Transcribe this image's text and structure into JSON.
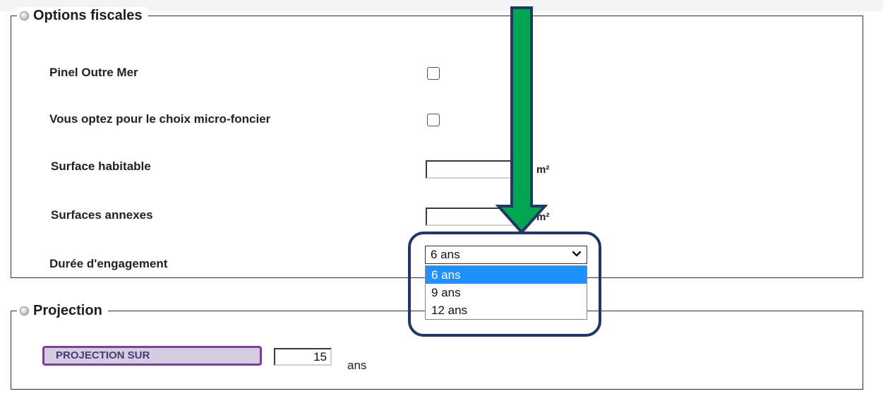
{
  "fiscal": {
    "title": "Options fiscales",
    "pinel_label": "Pinel Outre Mer",
    "microfoncier_label": "Vous optez pour le choix micro-foncier",
    "surface_label": "Surface habitable",
    "surface_unit": "m²",
    "annexes_label": "Surfaces annexes",
    "annexes_unit": "m²",
    "duree_label": "Durée d'engagement",
    "duree_selected": "6 ans",
    "duree_options": [
      "6 ans",
      "9 ans",
      "12 ans"
    ]
  },
  "projection": {
    "title": "Projection",
    "button_label": "PROJECTION SUR",
    "years_value": "15",
    "years_unit": "ans"
  },
  "colors": {
    "arrow_fill": "#00a651",
    "arrow_outline": "#203864",
    "highlight_border": "#203864",
    "dropdown_selected": "#1e90ff",
    "button_bg": "#d2cde2",
    "button_border": "#7d3e95"
  }
}
